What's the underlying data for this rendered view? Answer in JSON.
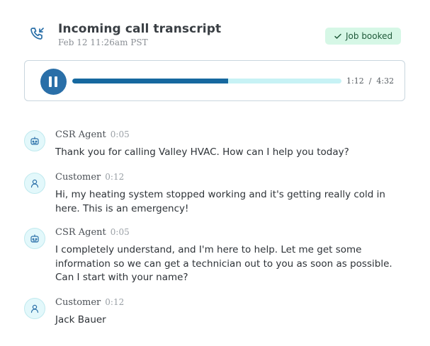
{
  "header": {
    "title": "Incoming call transcript",
    "subtitle": "Feb 12 11:26am PST",
    "badge": "Job booked",
    "icon": "incoming-call-icon"
  },
  "player": {
    "current_time": "1:12",
    "separator": "/",
    "total_time": "4:32",
    "progress_fraction": 0.58,
    "icon": "pause-icon"
  },
  "colors": {
    "accent": "#16689f",
    "track": "#c7f2f5",
    "badge_bg": "#d6f7e6",
    "avatar_bg": "#e3f8fb"
  },
  "messages": [
    {
      "speaker": "CSR Agent",
      "time": "0:05",
      "text": "Thank you for calling Valley HVAC. How can I help you today?",
      "icon": "robot-icon"
    },
    {
      "speaker": "Customer",
      "time": "0:12",
      "text": "Hi, my heating system stopped working and it's getting really cold in here. This is an emergency!",
      "icon": "user-icon"
    },
    {
      "speaker": "CSR Agent",
      "time": "0:05",
      "text": "I completely understand, and I'm here to help. Let me get some information so we can get a technician out to you as soon as possible. Can I start with your name?",
      "icon": "robot-icon"
    },
    {
      "speaker": "Customer",
      "time": "0:12",
      "text": "Jack Bauer",
      "icon": "user-icon"
    }
  ]
}
